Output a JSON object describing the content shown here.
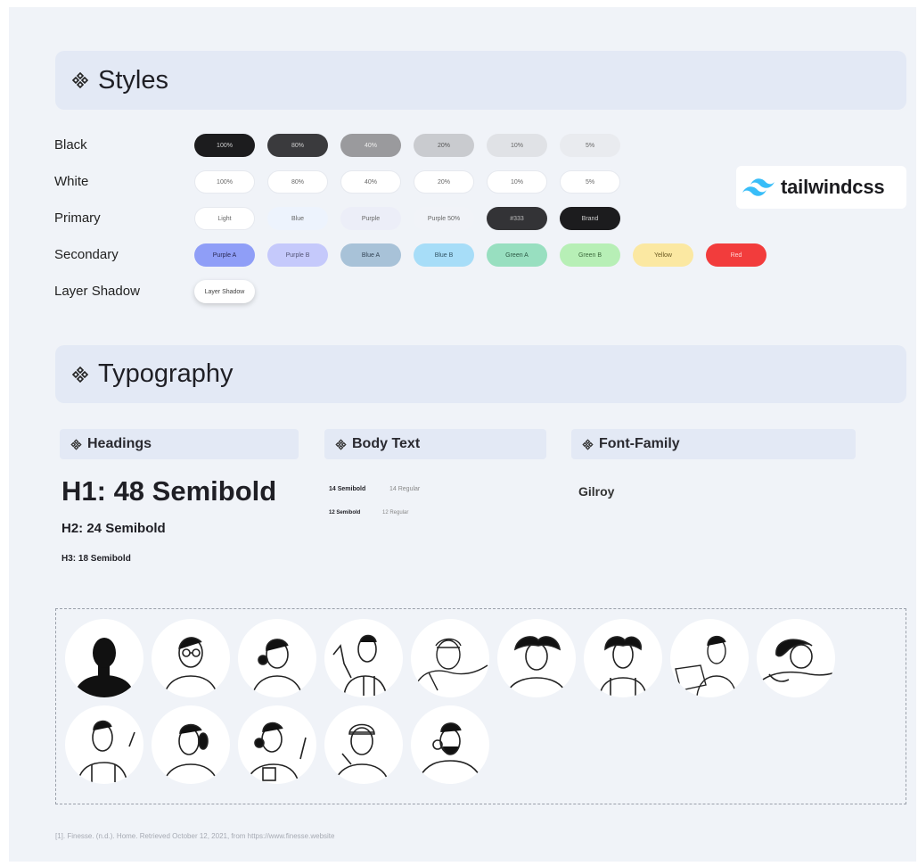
{
  "styles": {
    "title": "Styles",
    "icon": "component-diamond-icon",
    "rows": [
      {
        "label": "Black",
        "swatches": [
          {
            "text": "100%",
            "bg": "#1c1c1e",
            "fg": "#cfcfcf"
          },
          {
            "text": "80%",
            "bg": "#3a3a3d",
            "fg": "#d0d0d0"
          },
          {
            "text": "40%",
            "bg": "#9a9a9d",
            "fg": "#eeeeee"
          },
          {
            "text": "20%",
            "bg": "#c9cbcf",
            "fg": "#555555"
          },
          {
            "text": "10%",
            "bg": "#e0e2e6",
            "fg": "#666666"
          },
          {
            "text": "5%",
            "bg": "#e9ebef",
            "fg": "#666666"
          }
        ]
      },
      {
        "label": "White",
        "swatches": [
          {
            "text": "100%",
            "bg": "#ffffff",
            "fg": "#666666"
          },
          {
            "text": "80%",
            "bg": "#ffffff",
            "fg": "#666666"
          },
          {
            "text": "40%",
            "bg": "#ffffff",
            "fg": "#666666"
          },
          {
            "text": "20%",
            "bg": "#ffffff",
            "fg": "#666666"
          },
          {
            "text": "10%",
            "bg": "#ffffff",
            "fg": "#666666"
          },
          {
            "text": "5%",
            "bg": "#ffffff",
            "fg": "#666666"
          }
        ]
      },
      {
        "label": "Primary",
        "swatches": [
          {
            "text": "Light",
            "bg": "#ffffff",
            "fg": "#666666"
          },
          {
            "text": "Blue",
            "bg": "#edf3fd",
            "fg": "#666666"
          },
          {
            "text": "Purple",
            "bg": "#eceef8",
            "fg": "#666666"
          },
          {
            "text": "Purple 50%",
            "bg": "#f1f3f8",
            "fg": "#666666"
          },
          {
            "text": "#333",
            "bg": "#333336",
            "fg": "#bdbdbd"
          },
          {
            "text": "Brand",
            "bg": "#1c1c1e",
            "fg": "#cfcfcf"
          }
        ]
      },
      {
        "label": "Secondary",
        "swatches": [
          {
            "text": "Purple A",
            "bg": "#8f9ef7",
            "fg": "#2a2a55"
          },
          {
            "text": "Purple B",
            "bg": "#c5c9fb",
            "fg": "#555577"
          },
          {
            "text": "Blue A",
            "bg": "#a8c2d8",
            "fg": "#334455"
          },
          {
            "text": "Blue B",
            "bg": "#a7ddf8",
            "fg": "#335566"
          },
          {
            "text": "Green A",
            "bg": "#98dfc0",
            "fg": "#2d5a45"
          },
          {
            "text": "Green B",
            "bg": "#b7efb6",
            "fg": "#3d6a3d"
          },
          {
            "text": "Yellow",
            "bg": "#fbe8a2",
            "fg": "#6b5a22"
          },
          {
            "text": "Red",
            "bg": "#f23c3c",
            "fg": "#ffd0d0"
          }
        ]
      },
      {
        "label": "Layer Shadow",
        "swatches": [
          {
            "text": "Layer Shadow",
            "bg": "#ffffff",
            "fg": "#444444",
            "shadow": true
          }
        ]
      }
    ]
  },
  "logo": {
    "wordmark": "tailwindcss",
    "icon": "tailwind-wave-icon",
    "color": "#38bdf8"
  },
  "typography": {
    "title": "Typography",
    "headings": {
      "title": "Headings",
      "h1": "H1: 48 Semibold",
      "h2": "H2: 24 Semibold",
      "h3": "H3: 18 Semibold"
    },
    "body": {
      "title": "Body Text",
      "s14": "14 Semibold",
      "r14": "14 Regular",
      "s12": "12 Semibold",
      "r12": "12 Regular"
    },
    "font_family": {
      "title": "Font-Family",
      "value": "Gilroy"
    }
  },
  "avatars": [
    "avatar-silhouette",
    "avatar-glasses",
    "avatar-bun-woman",
    "avatar-waving-man",
    "avatar-headband-man",
    "avatar-curly-woman",
    "avatar-curly-woman-2",
    "avatar-man-with-laptop",
    "avatar-resting-woman",
    "avatar-man-overalls",
    "avatar-ponytail-woman",
    "avatar-woman-coffee",
    "avatar-beanie-man",
    "avatar-bearded-man"
  ],
  "footnote": "[1]. Finesse. (n.d.). Home. Retrieved October 12, 2021, from https://www.finesse.website"
}
